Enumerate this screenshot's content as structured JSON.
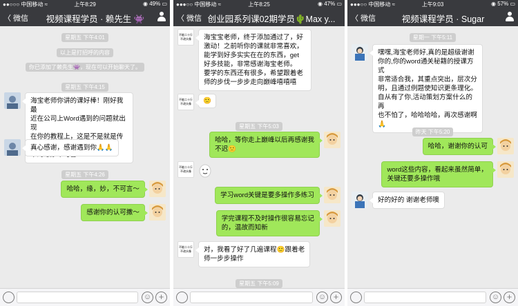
{
  "phones": [
    {
      "status": {
        "carrier": "●●○○○ 中国移动 ≈",
        "time": "上午8:29",
        "battery": "◉ 49% ▭"
      },
      "nav": {
        "back": "〈 微信",
        "title": "视频课程学员 · 赖先生 👾"
      },
      "chat": {
        "time1": "星期五 下午4:01",
        "sys1": "以上是打招呼的内容",
        "sys2": "你已添加了赖先生👾，现在可以开始聊天了。",
        "time2": "星期五 下午4:15",
        "msg1": [
          "海宝老师你讲的课好棒！刚好我最",
          "近在公司上Word遇到的问题就出现",
          "在你的教程上，这是不是就是传说",
          "中的缘妙不可言!"
        ],
        "msg2": "真心感谢，感谢遇到你🙏🙏",
        "time3": "星期五 下午4:26",
        "msg3": "哈哈，缘，妙，不可言～",
        "msg4": "感谢你的认可撒～"
      }
    },
    {
      "status": {
        "carrier": "●●●○○ 中国移动 ≈",
        "time": "上午8:25",
        "battery": "◉ 47% ▭"
      },
      "nav": {
        "back": "〈 微信",
        "title": "创业园系列课02期学员🌵Max y..."
      },
      "chat": {
        "msg1": [
          "海宝宝老师，终于添加通过了，好",
          "激动！之前听你的课就非常喜欢，",
          "能学到好多实实在在的东西，get",
          "好多技能，非常感谢海宝老师。",
          "要学的东西还有很多，希望跟着老",
          "师的步伐一步步走向巅峰嘻嘻嘻"
        ],
        "msg2": "🙂",
        "time1": "星期五 下午5:03",
        "msg3": [
          "哈哈，等你走上巅峰以后再感谢我",
          "不迟🙂"
        ],
        "msg4": "",
        "msg5": "学习word关键是要多操作多练习",
        "msg6": [
          "学完课程不及时操作很容易忘记",
          "的，温故而知新"
        ],
        "msg7": [
          "对，我看了好了几遍课程🙂跟着老",
          "师一步步操作"
        ],
        "time2": "星期五 下午5:09",
        "avatar_tag_line1": "不能二十斤",
        "avatar_tag_line2": "不改头像"
      }
    },
    {
      "status": {
        "carrier": "●●●○○ 中国移动 ≈",
        "time": "上午9:03",
        "battery": "◉ 57% ▭"
      },
      "nav": {
        "back": "〈 微信",
        "title": "视频课程学员 · Sugar"
      },
      "chat": {
        "time1": "星期一 下午5:11",
        "msg1": [
          "嘿嘿,海宝老师好,真的是超级谢谢",
          "你的,你的word通关秘籍的授课方式",
          "非常适合我，其重点突出，层次分",
          "明，且通过例题使知识更条理化。",
          "自从有了你,活动策划方案什么的再",
          "也不怕了，哈哈哈哈，再次感谢啊",
          "🙏"
        ],
        "time2": "昨天 下午5:20",
        "msg2": "哈哈，谢谢你的认可",
        "msg3": [
          "word这些内容，看起来虽然简单，",
          "关键还要多操作哦"
        ],
        "msg4": "好的好的 谢谢老师噢"
      }
    }
  ]
}
